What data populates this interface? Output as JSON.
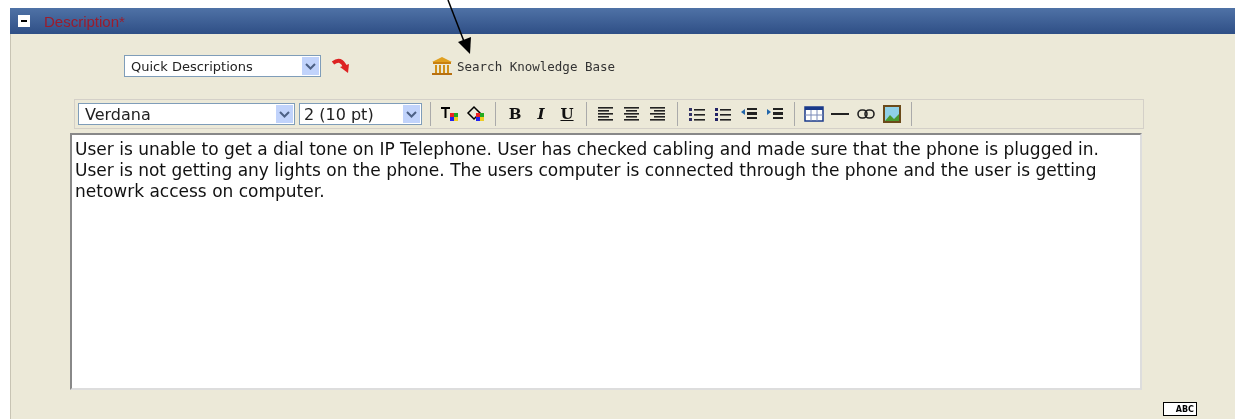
{
  "panel": {
    "title": "Description*",
    "expanded": true
  },
  "quick_descriptions": {
    "value": "Quick Descriptions"
  },
  "knowledge_base_link": "Search Knowledge Base",
  "toolbar": {
    "font": "Verdana",
    "size": "2 (10 pt)",
    "bold": "B",
    "italic": "I",
    "underline": "U"
  },
  "editor": {
    "value": "User is unable to get a dial tone on IP Telephone. User has checked cabling and made sure that the phone is plugged in. User is not getting any lights on the phone. The users computer is connected through the phone and the user is getting netowrk access on computer."
  },
  "spellcheck": {
    "label": "ABC"
  }
}
